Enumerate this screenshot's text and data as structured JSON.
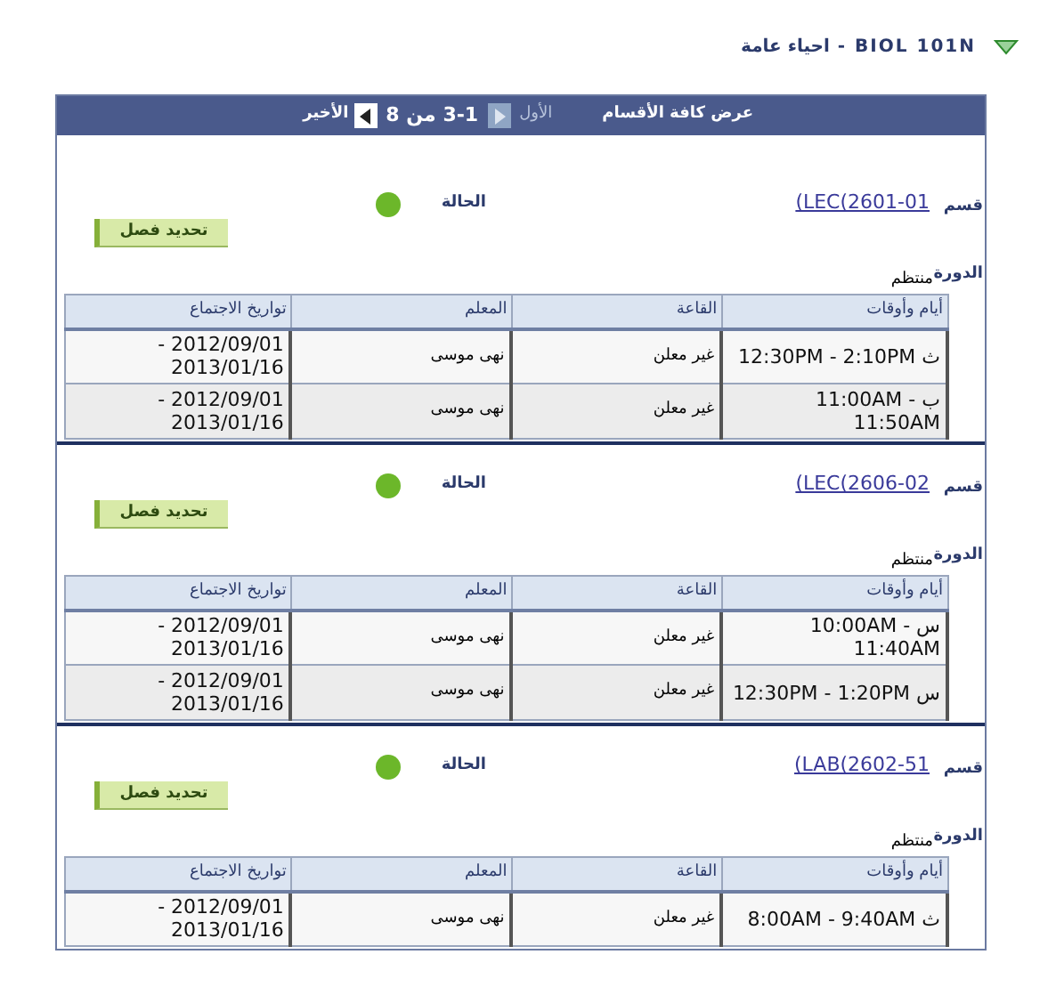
{
  "title": {
    "text": "BIOL 101N - احياء عامة",
    "expanded": true
  },
  "navigator": {
    "view_all": "عرض كافة الأقسام",
    "first": "الأول",
    "first_disabled": true,
    "range": "3-1 من 8",
    "last": "الأخير",
    "last_disabled": false
  },
  "sections": [
    {
      "section_label": "قسم",
      "section": "(LEC(2601-01",
      "status_label": "الحالة",
      "color": "#6cb72a",
      "button": "تحديد فصل",
      "session_label": "الدورة",
      "session": "منتظم",
      "columns": [
        "أيام وأوقات",
        "القاعة",
        "المعلم",
        "تواريخ الاجتماع"
      ],
      "rows": [
        [
          "ث 12:30PM - 2:10PM",
          "غير معلن",
          "نهى موسى",
          "2012/09/01 - 2013/01/16"
        ],
        [
          "ب 11:00AM - 11:50AM",
          "غير معلن",
          "نهى موسى",
          "2012/09/01 - 2013/01/16"
        ]
      ]
    },
    {
      "section_label": "قسم",
      "section": "(LEC(2606-02",
      "status_label": "الحالة",
      "color": "#6cb72a",
      "button": "تحديد فصل",
      "session_label": "الدورة",
      "session": "منتظم",
      "columns": [
        "أيام وأوقات",
        "القاعة",
        "المعلم",
        "تواريخ الاجتماع"
      ],
      "rows": [
        [
          "س 10:00AM - 11:40AM",
          "غير معلن",
          "نهى موسى",
          "2012/09/01 - 2013/01/16"
        ],
        [
          "س 12:30PM - 1:20PM",
          "غير معلن",
          "نهى موسى",
          "2012/09/01 - 2013/01/16"
        ]
      ]
    },
    {
      "section_label": "قسم",
      "section": "(LAB(2602-51",
      "status_label": "الحالة",
      "color": "#6cb72a",
      "button": "تحديد فصل",
      "session_label": "الدورة",
      "session": "منتظم",
      "columns": [
        "أيام وأوقات",
        "القاعة",
        "المعلم",
        "تواريخ الاجتماع"
      ],
      "rows": [
        [
          "ث 8:00AM - 9:40AM",
          "غير معلن",
          "نهى موسى",
          "2012/09/01 - 2013/01/16"
        ]
      ]
    }
  ]
}
